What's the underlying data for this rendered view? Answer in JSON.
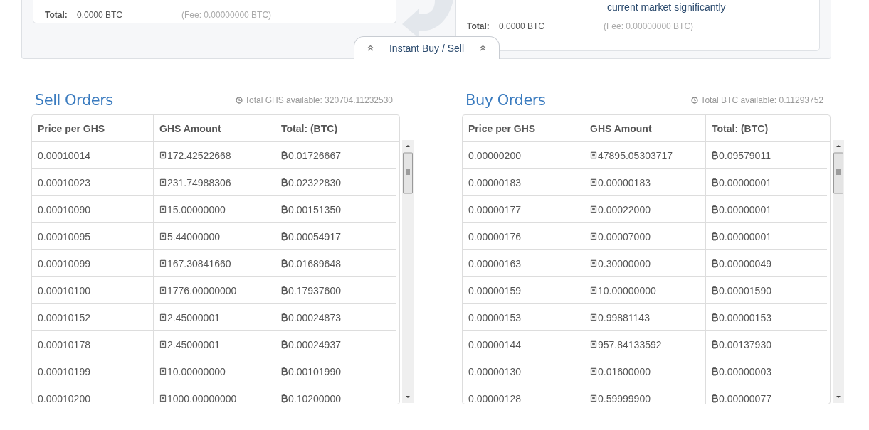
{
  "instant_panel": {
    "sell_card": {
      "total_label": "Total:",
      "total_value": "0.0000 BTC",
      "fee": "(Fee: 0.00000000 BTC)"
    },
    "buy_card": {
      "note": "current market significantly",
      "total_label": "Total:",
      "total_value": "0.0000 BTC",
      "fee": "(Fee: 0.00000000 BTC)"
    },
    "toggle_tab": {
      "label": "Instant Buy / Sell"
    }
  },
  "order_books": [
    {
      "title": "Sell Orders",
      "available": "Total GHS available: 320704.11232530",
      "columns": [
        "Price per GHS",
        "GHS Amount",
        "Total: (BTC)"
      ],
      "rows": [
        [
          "0.00010014",
          "172.42522668",
          "0.01726667"
        ],
        [
          "0.00010023",
          "231.74988306",
          "0.02322830"
        ],
        [
          "0.00010090",
          "15.00000000",
          "0.00151350"
        ],
        [
          "0.00010095",
          "5.44000000",
          "0.00054917"
        ],
        [
          "0.00010099",
          "167.30841660",
          "0.01689648"
        ],
        [
          "0.00010100",
          "1776.00000000",
          "0.17937600"
        ],
        [
          "0.00010152",
          "2.45000001",
          "0.00024873"
        ],
        [
          "0.00010178",
          "2.45000001",
          "0.00024937"
        ],
        [
          "0.00010199",
          "10.00000000",
          "0.00101990"
        ],
        [
          "0.00010200",
          "1000.00000000",
          "0.10200000"
        ]
      ]
    },
    {
      "title": "Buy Orders",
      "available": "Total BTC available: 0.11293752",
      "columns": [
        "Price per GHS",
        "GHS Amount",
        "Total: (BTC)"
      ],
      "rows": [
        [
          "0.00000200",
          "47895.05303717",
          "0.09579011"
        ],
        [
          "0.00000183",
          "0.00000183",
          "0.00000001"
        ],
        [
          "0.00000177",
          "0.00022000",
          "0.00000001"
        ],
        [
          "0.00000176",
          "0.00007000",
          "0.00000001"
        ],
        [
          "0.00000163",
          "0.30000000",
          "0.00000049"
        ],
        [
          "0.00000159",
          "10.00000000",
          "0.00001590"
        ],
        [
          "0.00000153",
          "0.99881143",
          "0.00000153"
        ],
        [
          "0.00000144",
          "957.84133592",
          "0.00137930"
        ],
        [
          "0.00000130",
          "0.01600000",
          "0.00000003"
        ],
        [
          "0.00000128",
          "0.59999900",
          "0.00000077"
        ]
      ]
    }
  ]
}
